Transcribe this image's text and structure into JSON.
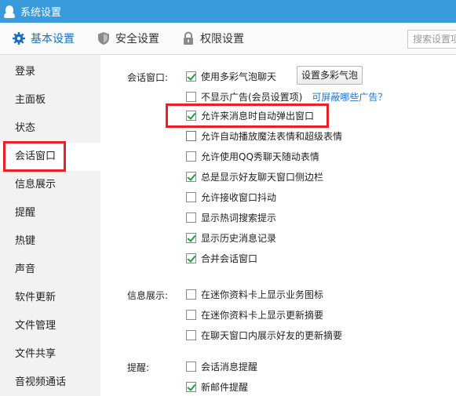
{
  "window": {
    "title": "系统设置"
  },
  "tabs": [
    {
      "label": "基本设置",
      "icon": "gear-icon",
      "active": true
    },
    {
      "label": "安全设置",
      "icon": "shield-icon",
      "active": false
    },
    {
      "label": "权限设置",
      "icon": "lock-icon",
      "active": false
    }
  ],
  "search": {
    "placeholder": "搜索设置项"
  },
  "sidebar": {
    "items": [
      {
        "label": "登录"
      },
      {
        "label": "主面板"
      },
      {
        "label": "状态"
      },
      {
        "label": "会话窗口",
        "active": true
      },
      {
        "label": "信息展示"
      },
      {
        "label": "提醒"
      },
      {
        "label": "热键"
      },
      {
        "label": "声音"
      },
      {
        "label": "软件更新"
      },
      {
        "label": "文件管理"
      },
      {
        "label": "文件共享"
      },
      {
        "label": "音视频通话"
      }
    ]
  },
  "sections": {
    "chat": {
      "label": "会话窗口:",
      "button": "设置多彩气泡",
      "link": "可屏蔽哪些广告？",
      "options": [
        {
          "label": "使用多彩气泡聊天",
          "checked": true
        },
        {
          "label": "不显示广告(会员设置项)",
          "checked": false
        },
        {
          "label": "允许来消息时自动弹出窗口",
          "checked": true
        },
        {
          "label": "允许自动播放魔法表情和超级表情",
          "checked": false
        },
        {
          "label": "允许使用QQ秀聊天随动表情",
          "checked": false
        },
        {
          "label": "总是显示好友聊天窗口侧边栏",
          "checked": true
        },
        {
          "label": "允许接收窗口抖动",
          "checked": false
        },
        {
          "label": "显示热词搜索提示",
          "checked": false
        },
        {
          "label": "显示历史消息记录",
          "checked": true
        },
        {
          "label": "合并会话窗口",
          "checked": true
        }
      ]
    },
    "info": {
      "label": "信息展示:",
      "options": [
        {
          "label": "在迷你资料卡上显示业务图标",
          "checked": false
        },
        {
          "label": "在迷你资料卡上显示更新摘要",
          "checked": false
        },
        {
          "label": "在聊天窗口内展示好友的更新摘要",
          "checked": false
        }
      ]
    },
    "remind": {
      "label": "提醒:",
      "options": [
        {
          "label": "会话消息提醒",
          "checked": false
        },
        {
          "label": "新邮件提醒",
          "checked": true
        }
      ]
    }
  },
  "colors": {
    "titlebar": "#3a9bdc",
    "accent": "#1a6fc0",
    "highlight": "#e8202a",
    "check": "#1aa038"
  }
}
